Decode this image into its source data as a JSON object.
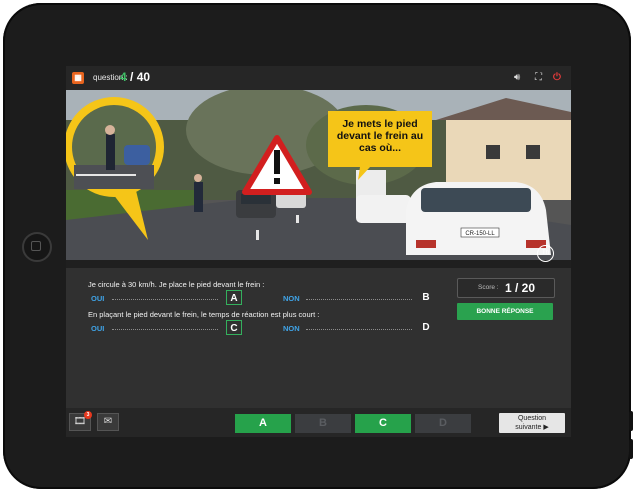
{
  "header": {
    "question_label": "question :",
    "current": "4",
    "total": "/ 40",
    "logo_icon": "app-logo-icon",
    "volume_icon": "speaker-icon",
    "fullscreen_icon": "fullscreen-icon",
    "quit_icon": "power-icon"
  },
  "photo": {
    "bubble_text": "Je mets le pied devant le frein au cas où...",
    "watermark": "Th",
    "plate": "CR-150-LL"
  },
  "questions": [
    {
      "text": "Je circule à 30 km/h. Je place le pied devant le frein :",
      "answer1": "OUI",
      "letter1": "A",
      "answer2": "NON",
      "letter2": "B"
    },
    {
      "text": "En plaçant le pied devant le frein, le temps de réaction est plus court :",
      "answer1": "OUI",
      "letter1": "C",
      "answer2": "NON",
      "letter2": "D"
    }
  ],
  "score": {
    "label": "Score :",
    "value": "1 / 20"
  },
  "result": {
    "label": "BONNE RÉPONSE"
  },
  "bottom": {
    "keys": [
      "A",
      "B",
      "C",
      "D"
    ],
    "selected": [
      "A",
      "C"
    ],
    "next_line1": "Question",
    "next_line2": "suivante",
    "notification_count": "3",
    "colors": {
      "accent": "#26a24b",
      "answer": "#3fa3e6",
      "bubble": "#f5c518"
    }
  }
}
